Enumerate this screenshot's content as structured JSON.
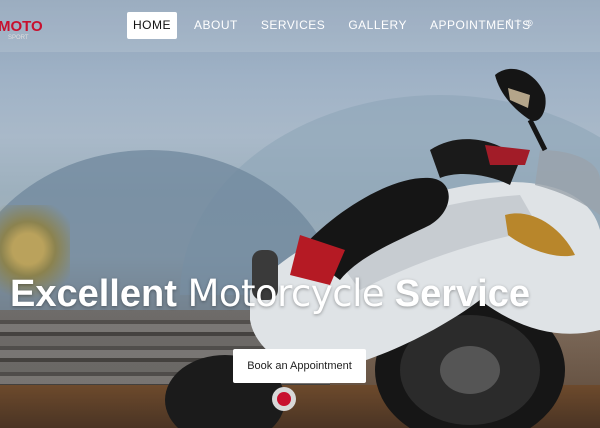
{
  "logo": {
    "text": "MOTO",
    "sub": "SPORT"
  },
  "nav": {
    "items": [
      "HOME",
      "ABOUT",
      "SERVICES",
      "GALLERY",
      "APPOINTMENTS"
    ],
    "active": "HOME"
  },
  "social": {
    "icons": [
      "facebook-icon",
      "twitter-icon",
      "instagram-icon"
    ],
    "glyphs": [
      "f",
      "t",
      "◎"
    ]
  },
  "hero": {
    "headline_word1": "Excellent",
    "headline_word2": "Motorcycle",
    "headline_word3": "Service",
    "cta_label": "Book an Appointment"
  },
  "colors": {
    "accent": "#c8102e",
    "nav_text": "#ffffff",
    "button_bg": "#ffffff"
  }
}
